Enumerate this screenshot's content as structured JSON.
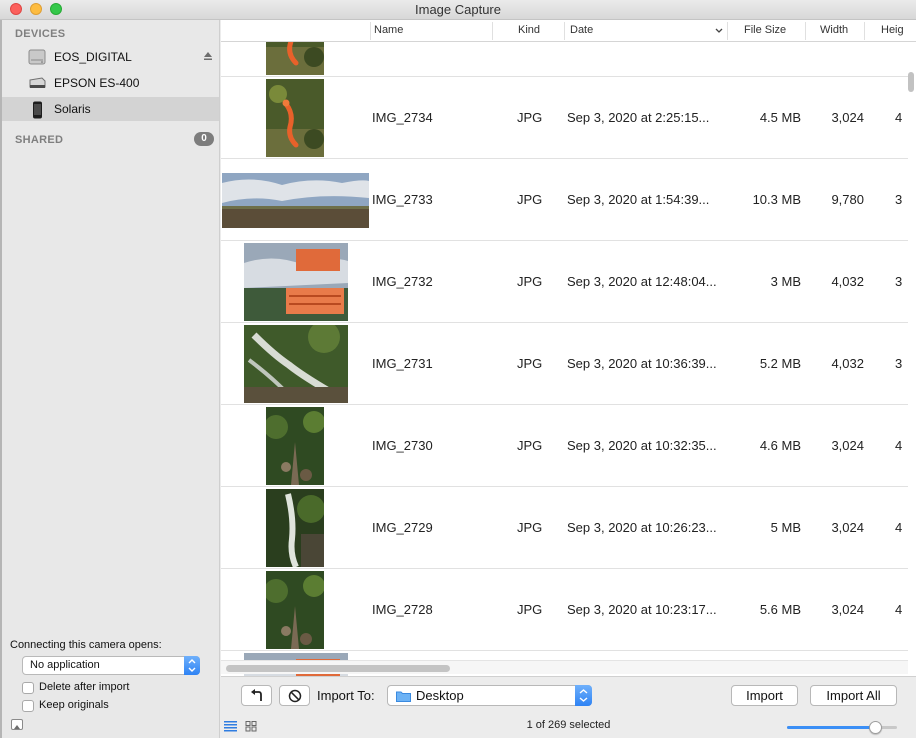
{
  "window": {
    "title": "Image Capture"
  },
  "sidebar": {
    "devices_header": "DEVICES",
    "devices": [
      {
        "label": "EOS_DIGITAL",
        "icon": "drive-icon",
        "selected": false,
        "ejectable": true
      },
      {
        "label": "EPSON ES-400",
        "icon": "scanner-icon",
        "selected": false,
        "ejectable": false
      },
      {
        "label": "Solaris",
        "icon": "phone-icon",
        "selected": true,
        "ejectable": false
      }
    ],
    "shared_header": "SHARED",
    "shared_count": "0",
    "connecting_label": "Connecting this camera opens:",
    "connecting_value": "No application",
    "delete_after_import_label": "Delete after import",
    "keep_originals_label": "Keep originals",
    "delete_after_import_checked": false,
    "keep_originals_checked": false
  },
  "table": {
    "columns": [
      "Name",
      "Kind",
      "Date",
      "File Size",
      "Width",
      "Heig"
    ],
    "rows": [
      {
        "name": "",
        "kind": "",
        "date": "",
        "size": "",
        "width": "",
        "extra": "",
        "thumb_style": "newt"
      },
      {
        "name": "IMG_2734",
        "kind": "JPG",
        "date": "Sep 3, 2020 at 2:25:15...",
        "size": "4.5 MB",
        "width": "3,024",
        "extra": "4",
        "thumb_style": "newt"
      },
      {
        "name": "IMG_2733",
        "kind": "JPG",
        "date": "Sep 3, 2020 at 1:54:39...",
        "size": "10.3 MB",
        "width": "9,780",
        "extra": "3",
        "thumb_style": "panorama"
      },
      {
        "name": "IMG_2732",
        "kind": "JPG",
        "date": "Sep 3, 2020 at 12:48:04...",
        "size": "3 MB",
        "width": "4,032",
        "extra": "3",
        "thumb_style": "sign"
      },
      {
        "name": "IMG_2731",
        "kind": "JPG",
        "date": "Sep 3, 2020 at 10:36:39...",
        "size": "5.2 MB",
        "width": "4,032",
        "extra": "3",
        "thumb_style": "stream"
      },
      {
        "name": "IMG_2730",
        "kind": "JPG",
        "date": "Sep 3, 2020 at 10:32:35...",
        "size": "4.6 MB",
        "width": "3,024",
        "extra": "4",
        "thumb_style": "trail"
      },
      {
        "name": "IMG_2729",
        "kind": "JPG",
        "date": "Sep 3, 2020 at 10:26:23...",
        "size": "5 MB",
        "width": "3,024",
        "extra": "4",
        "thumb_style": "cascade"
      },
      {
        "name": "IMG_2728",
        "kind": "JPG",
        "date": "Sep 3, 2020 at 10:23:17...",
        "size": "5.6 MB",
        "width": "3,024",
        "extra": "4",
        "thumb_style": "trail"
      },
      {
        "name": "",
        "kind": "",
        "date": "",
        "size": "",
        "width": "",
        "extra": "",
        "thumb_style": "sign"
      }
    ]
  },
  "toolbar": {
    "rotate_icon": "rotate-left-icon",
    "delete_icon": "delete-icon",
    "import_to_label": "Import To:",
    "destination": "Desktop",
    "import_label": "Import",
    "import_all_label": "Import All",
    "status": "1 of 269 selected",
    "thumbnail_size_level": 0.8
  },
  "colors": {
    "accent": "#3b8ff6",
    "close": "#fc605c",
    "minimize": "#fdbc40",
    "zoom": "#34c84a"
  }
}
